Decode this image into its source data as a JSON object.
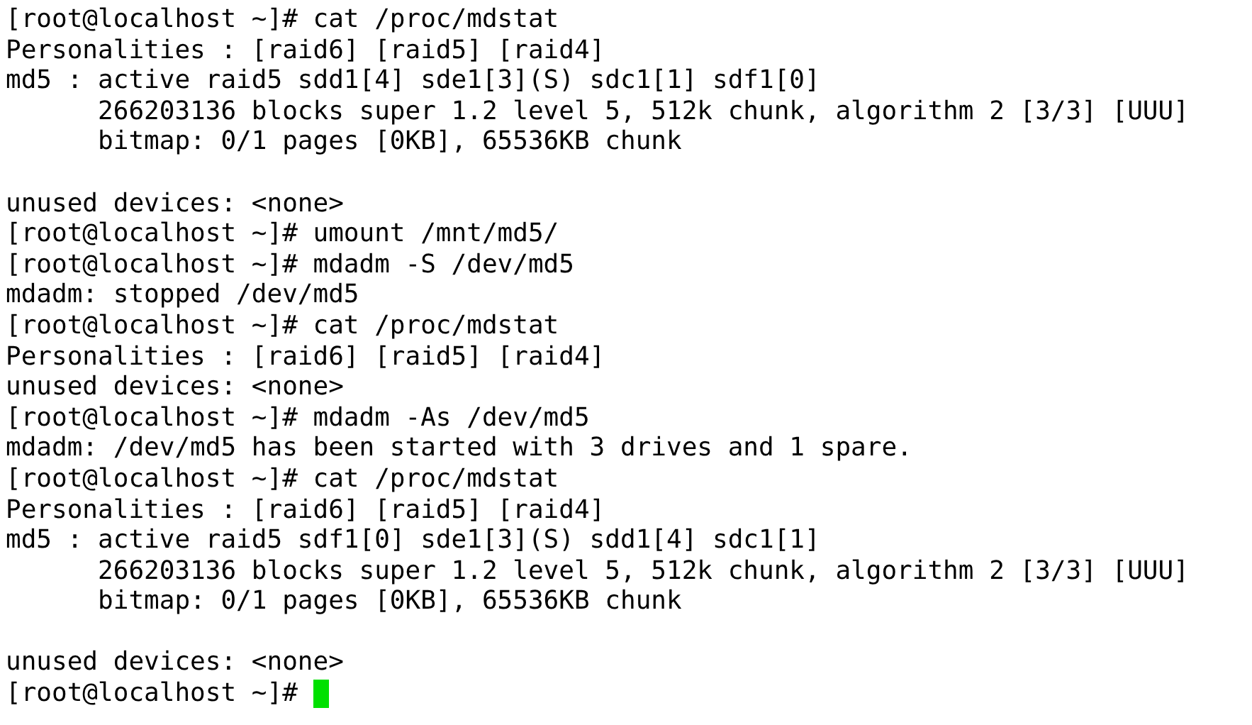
{
  "terminal": {
    "lines": [
      {
        "kind": "text",
        "text": "[root@localhost ~]# cat /proc/mdstat",
        "cursor": false
      },
      {
        "kind": "text",
        "text": "Personalities : [raid6] [raid5] [raid4]",
        "cursor": false
      },
      {
        "kind": "text",
        "text": "md5 : active raid5 sdd1[4] sde1[3](S) sdc1[1] sdf1[0]",
        "cursor": false
      },
      {
        "kind": "text",
        "text": "      266203136 blocks super 1.2 level 5, 512k chunk, algorithm 2 [3/3] [UUU]",
        "cursor": false
      },
      {
        "kind": "text",
        "text": "      bitmap: 0/1 pages [0KB], 65536KB chunk",
        "cursor": false
      },
      {
        "kind": "blank",
        "cursor": false
      },
      {
        "kind": "text",
        "text": "unused devices: <none>",
        "cursor": false
      },
      {
        "kind": "text",
        "text": "[root@localhost ~]# umount /mnt/md5/",
        "cursor": false
      },
      {
        "kind": "text",
        "text": "[root@localhost ~]# mdadm -S /dev/md5",
        "cursor": false
      },
      {
        "kind": "text",
        "text": "mdadm: stopped /dev/md5",
        "cursor": false
      },
      {
        "kind": "text",
        "text": "[root@localhost ~]# cat /proc/mdstat",
        "cursor": false
      },
      {
        "kind": "text",
        "text": "Personalities : [raid6] [raid5] [raid4]",
        "cursor": false
      },
      {
        "kind": "text",
        "text": "unused devices: <none>",
        "cursor": false
      },
      {
        "kind": "text",
        "text": "[root@localhost ~]# mdadm -As /dev/md5",
        "cursor": false
      },
      {
        "kind": "text",
        "text": "mdadm: /dev/md5 has been started with 3 drives and 1 spare.",
        "cursor": false
      },
      {
        "kind": "text",
        "text": "[root@localhost ~]# cat /proc/mdstat",
        "cursor": false
      },
      {
        "kind": "text",
        "text": "Personalities : [raid6] [raid5] [raid4]",
        "cursor": false
      },
      {
        "kind": "text",
        "text": "md5 : active raid5 sdf1[0] sde1[3](S) sdd1[4] sdc1[1]",
        "cursor": false
      },
      {
        "kind": "text",
        "text": "      266203136 blocks super 1.2 level 5, 512k chunk, algorithm 2 [3/3] [UUU]",
        "cursor": false
      },
      {
        "kind": "text",
        "text": "      bitmap: 0/1 pages [0KB], 65536KB chunk",
        "cursor": false
      },
      {
        "kind": "blank",
        "cursor": false
      },
      {
        "kind": "text",
        "text": "unused devices: <none>",
        "cursor": false
      },
      {
        "kind": "text",
        "text": "[root@localhost ~]# ",
        "cursor": true
      }
    ]
  }
}
